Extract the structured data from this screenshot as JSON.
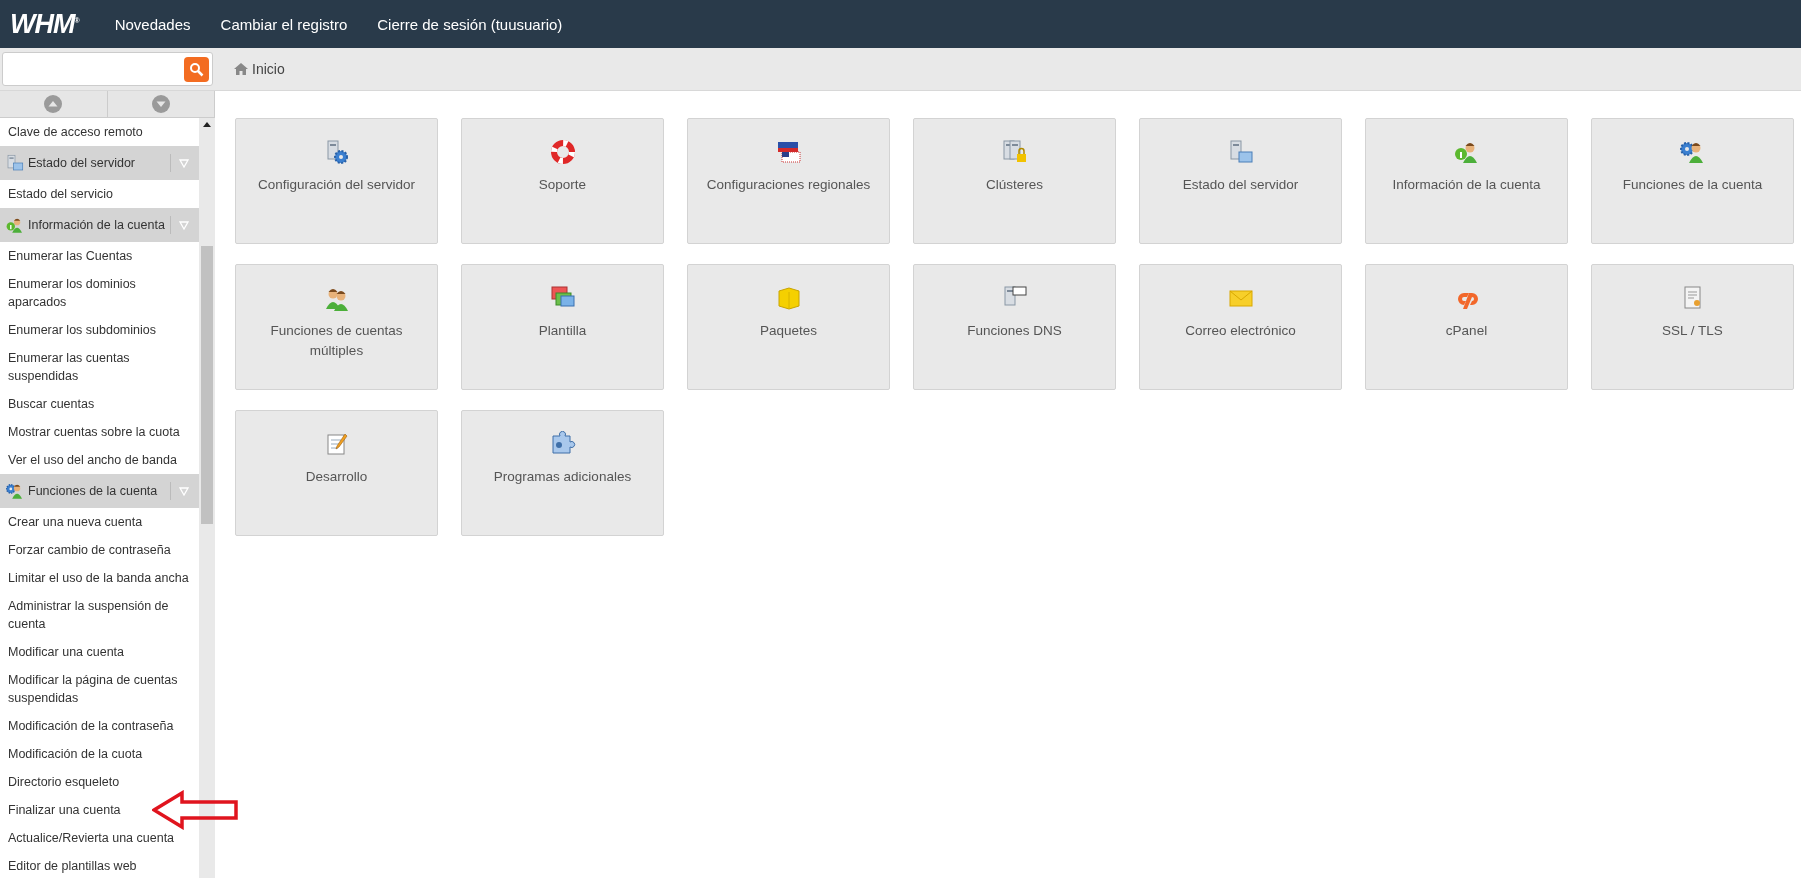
{
  "header": {
    "logo": "WHM$^{®}$",
    "nav": [
      "Novedades",
      "Cambiar el registro",
      "Cierre de sesión (tuusuario)"
    ]
  },
  "breadcrumb": {
    "label": "Inicio"
  },
  "sidebar": {
    "items": [
      {
        "kind": "link",
        "label": "Clave de acceso remoto"
      },
      {
        "kind": "section",
        "label": "Estado del servidor",
        "children": [
          {
            "label": "Estado del servicio"
          }
        ]
      },
      {
        "kind": "section",
        "label": "Información de la cuenta",
        "children": [
          {
            "label": "Enumerar las Cuentas"
          },
          {
            "label": "Enumerar los dominios aparcados"
          },
          {
            "label": "Enumerar los subdominios"
          },
          {
            "label": "Enumerar las cuentas suspendidas"
          },
          {
            "label": "Buscar cuentas"
          },
          {
            "label": "Mostrar cuentas sobre la cuota"
          },
          {
            "label": "Ver el uso del ancho de banda"
          }
        ]
      },
      {
        "kind": "section",
        "label": "Funciones de la cuenta",
        "children": [
          {
            "label": "Crear una nueva cuenta"
          },
          {
            "label": "Forzar cambio de contraseña"
          },
          {
            "label": "Limitar el uso de la banda ancha"
          },
          {
            "label": "Administrar la suspensión de cuenta"
          },
          {
            "label": "Modificar una cuenta"
          },
          {
            "label": "Modificar la página de cuentas suspendidas"
          },
          {
            "label": "Modificación de la contraseña"
          },
          {
            "label": "Modificación de la cuota"
          },
          {
            "label": "Directorio esqueleto"
          },
          {
            "label": "Finalizar una cuenta"
          },
          {
            "label": "Actualice/Revierta una cuenta"
          },
          {
            "label": "Editor de plantillas web"
          }
        ]
      }
    ]
  },
  "tiles": [
    {
      "label": "Configuración del servidor"
    },
    {
      "label": "Soporte"
    },
    {
      "label": "Configuraciones regionales"
    },
    {
      "label": "Clústeres"
    },
    {
      "label": "Estado del servidor"
    },
    {
      "label": "Información de la cuenta"
    },
    {
      "label": "Funciones de la cuenta"
    },
    {
      "label": "Funciones de cuentas múltiples"
    },
    {
      "label": "Plantilla"
    },
    {
      "label": "Paquetes"
    },
    {
      "label": "Funciones DNS"
    },
    {
      "label": "Correo electrónico"
    },
    {
      "label": "cPanel"
    },
    {
      "label": "SSL / TLS"
    },
    {
      "label": "Desarrollo"
    },
    {
      "label": "Programas adicionales"
    }
  ]
}
